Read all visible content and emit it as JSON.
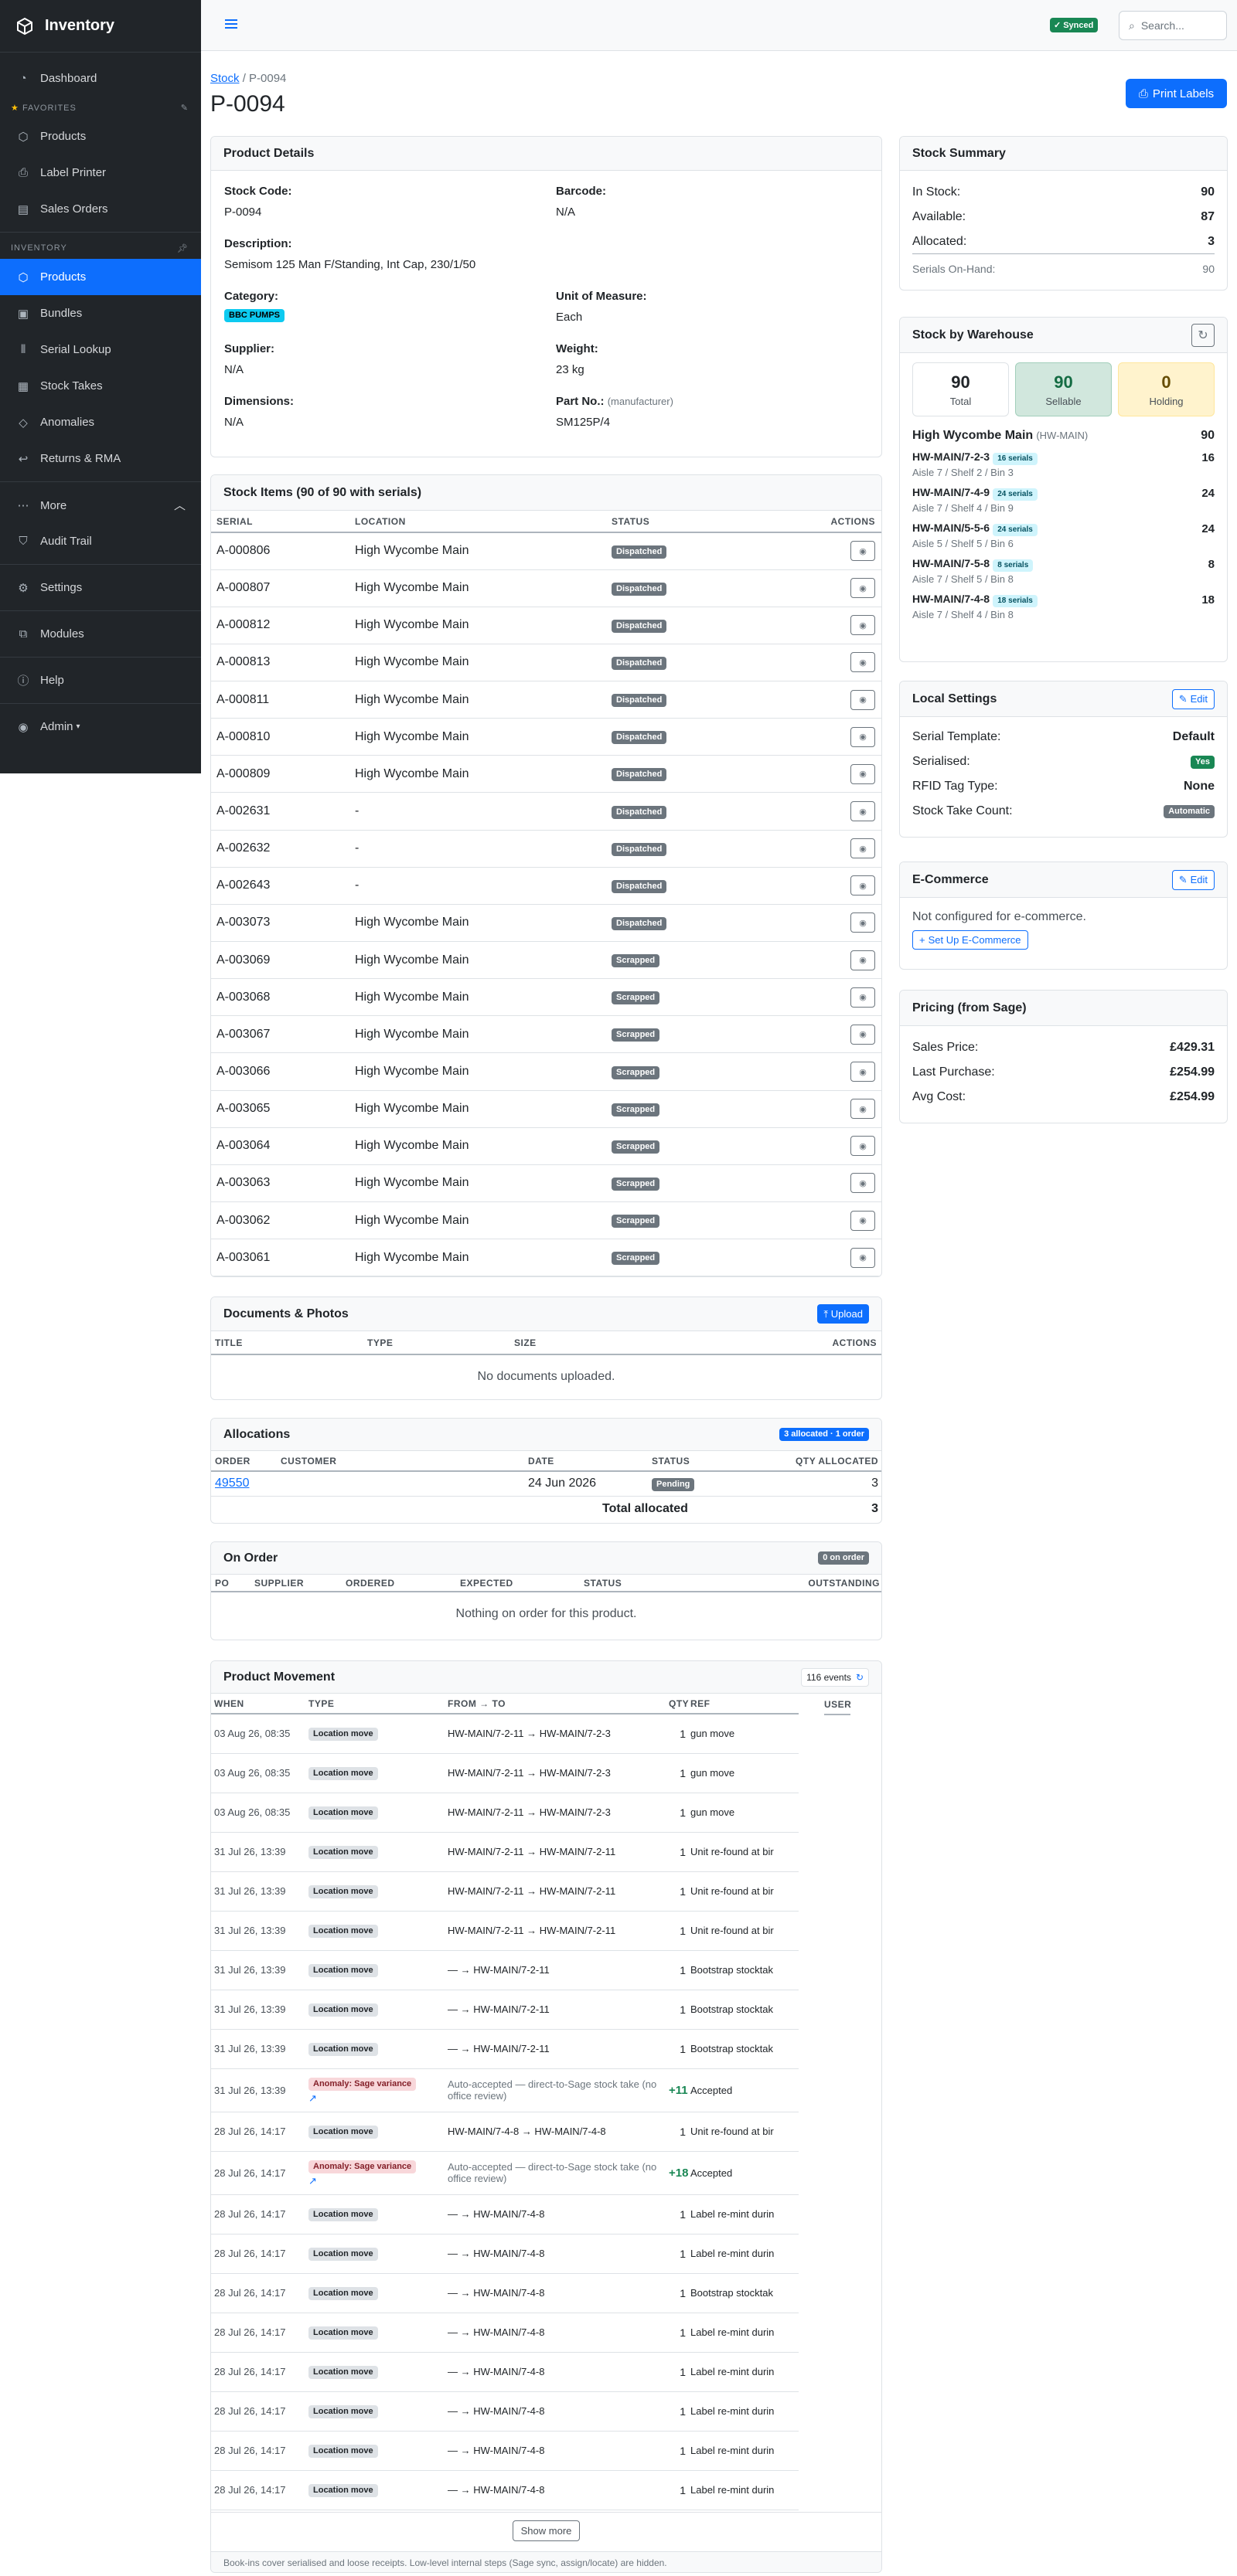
{
  "app": {
    "name": "Inventory"
  },
  "sidebar": {
    "dashboard": "Dashboard",
    "favorites_header": "FAVORITES",
    "favorites": [
      "Products",
      "Label Printer",
      "Sales Orders"
    ],
    "inventory_header": "INVENTORY",
    "inventory": [
      "Products",
      "Bundles",
      "Serial Lookup",
      "Stock Takes",
      "Anomalies",
      "Returns & RMA"
    ],
    "more": "More",
    "more_items": [
      "Audit Trail",
      "Settings",
      "Modules",
      "Help"
    ],
    "user": "Admin"
  },
  "topbar": {
    "synced": "Synced",
    "search_placeholder": "Search..."
  },
  "breadcrumb": {
    "root": "Stock",
    "current": "P-0094"
  },
  "page": {
    "title": "P-0094",
    "print_labels": "Print Labels"
  },
  "product_details": {
    "header": "Product Details",
    "stock_code_label": "Stock Code:",
    "stock_code": "P-0094",
    "barcode_label": "Barcode:",
    "barcode": "N/A",
    "description_label": "Description:",
    "description": "Semisom 125 Man F/Standing, Int Cap, 230/1/50",
    "category_label": "Category:",
    "category": "BBC PUMPS",
    "uom_label": "Unit of Measure:",
    "uom": "Each",
    "supplier_label": "Supplier:",
    "supplier": "N/A",
    "weight_label": "Weight:",
    "weight": "23 kg",
    "dimensions_label": "Dimensions:",
    "dimensions": "N/A",
    "partno_label": "Part No.:",
    "partno_hint": "(manufacturer)",
    "partno": "SM125P/4"
  },
  "stock_items": {
    "header": "Stock Items (90 of 90 with serials)",
    "columns": [
      "SERIAL",
      "LOCATION",
      "STATUS",
      "ACTIONS"
    ],
    "rows": [
      {
        "serial": "A-000806",
        "location": "High Wycombe Main",
        "status": "Dispatched"
      },
      {
        "serial": "A-000807",
        "location": "High Wycombe Main",
        "status": "Dispatched"
      },
      {
        "serial": "A-000812",
        "location": "High Wycombe Main",
        "status": "Dispatched"
      },
      {
        "serial": "A-000813",
        "location": "High Wycombe Main",
        "status": "Dispatched"
      },
      {
        "serial": "A-000811",
        "location": "High Wycombe Main",
        "status": "Dispatched"
      },
      {
        "serial": "A-000810",
        "location": "High Wycombe Main",
        "status": "Dispatched"
      },
      {
        "serial": "A-000809",
        "location": "High Wycombe Main",
        "status": "Dispatched"
      },
      {
        "serial": "A-002631",
        "location": "-",
        "status": "Dispatched"
      },
      {
        "serial": "A-002632",
        "location": "-",
        "status": "Dispatched"
      },
      {
        "serial": "A-002643",
        "location": "-",
        "status": "Dispatched"
      },
      {
        "serial": "A-003073",
        "location": "High Wycombe Main",
        "status": "Dispatched"
      },
      {
        "serial": "A-003069",
        "location": "High Wycombe Main",
        "status": "Scrapped"
      },
      {
        "serial": "A-003068",
        "location": "High Wycombe Main",
        "status": "Scrapped"
      },
      {
        "serial": "A-003067",
        "location": "High Wycombe Main",
        "status": "Scrapped"
      },
      {
        "serial": "A-003066",
        "location": "High Wycombe Main",
        "status": "Scrapped"
      },
      {
        "serial": "A-003065",
        "location": "High Wycombe Main",
        "status": "Scrapped"
      },
      {
        "serial": "A-003064",
        "location": "High Wycombe Main",
        "status": "Scrapped"
      },
      {
        "serial": "A-003063",
        "location": "High Wycombe Main",
        "status": "Scrapped"
      },
      {
        "serial": "A-003062",
        "location": "High Wycombe Main",
        "status": "Scrapped"
      },
      {
        "serial": "A-003061",
        "location": "High Wycombe Main",
        "status": "Scrapped"
      }
    ]
  },
  "documents": {
    "header": "Documents & Photos",
    "upload": "Upload",
    "columns": [
      "TITLE",
      "TYPE",
      "SIZE",
      "ACTIONS"
    ],
    "empty": "No documents uploaded."
  },
  "allocations": {
    "header": "Allocations",
    "badge": "3 allocated · 1 order",
    "columns": [
      "ORDER",
      "CUSTOMER",
      "DATE",
      "STATUS",
      "QTY ALLOCATED"
    ],
    "rows": [
      {
        "order": "49550",
        "customer": "",
        "date": "24 Jun 2026",
        "status": "Pending",
        "qty": "3"
      }
    ],
    "total_label": "Total allocated",
    "total": "3"
  },
  "on_order": {
    "header": "On Order",
    "badge": "0 on order",
    "columns": [
      "PO",
      "SUPPLIER",
      "ORDERED",
      "EXPECTED",
      "STATUS",
      "OUTSTANDING"
    ],
    "empty": "Nothing on order for this product."
  },
  "movement": {
    "header": "Product Movement",
    "events": "116 events",
    "columns": [
      "WHEN",
      "TYPE",
      "FROM → TO",
      "QTY",
      "REF",
      "USER"
    ],
    "rows": [
      {
        "when": "03 Aug 26, 08:35",
        "type": "Location move",
        "fromto": "HW-MAIN/7-2-11 → HW-MAIN/7-2-3",
        "qty": "1",
        "ref": "gun move"
      },
      {
        "when": "03 Aug 26, 08:35",
        "type": "Location move",
        "fromto": "HW-MAIN/7-2-11 → HW-MAIN/7-2-3",
        "qty": "1",
        "ref": "gun move"
      },
      {
        "when": "03 Aug 26, 08:35",
        "type": "Location move",
        "fromto": "HW-MAIN/7-2-11 → HW-MAIN/7-2-3",
        "qty": "1",
        "ref": "gun move"
      },
      {
        "when": "31 Jul 26, 13:39",
        "type": "Location move",
        "fromto": "HW-MAIN/7-2-11 → HW-MAIN/7-2-11",
        "qty": "1",
        "ref": "Unit re-found at bir"
      },
      {
        "when": "31 Jul 26, 13:39",
        "type": "Location move",
        "fromto": "HW-MAIN/7-2-11 → HW-MAIN/7-2-11",
        "qty": "1",
        "ref": "Unit re-found at bir"
      },
      {
        "when": "31 Jul 26, 13:39",
        "type": "Location move",
        "fromto": "HW-MAIN/7-2-11 → HW-MAIN/7-2-11",
        "qty": "1",
        "ref": "Unit re-found at bir"
      },
      {
        "when": "31 Jul 26, 13:39",
        "type": "Location move",
        "fromto": "— → HW-MAIN/7-2-11",
        "qty": "1",
        "ref": "Bootstrap stocktak"
      },
      {
        "when": "31 Jul 26, 13:39",
        "type": "Location move",
        "fromto": "— → HW-MAIN/7-2-11",
        "qty": "1",
        "ref": "Bootstrap stocktak"
      },
      {
        "when": "31 Jul 26, 13:39",
        "type": "Location move",
        "fromto": "— → HW-MAIN/7-2-11",
        "qty": "1",
        "ref": "Bootstrap stocktak"
      },
      {
        "when": "31 Jul 26, 13:39",
        "type": "Anomaly: Sage variance",
        "anomaly": true,
        "fromto": "Auto-accepted — direct-to-Sage stock take (no office review)",
        "qty": "+11",
        "ref": "Accepted"
      },
      {
        "when": "28 Jul 26, 14:17",
        "type": "Location move",
        "fromto": "HW-MAIN/7-4-8 → HW-MAIN/7-4-8",
        "qty": "1",
        "ref": "Unit re-found at bir"
      },
      {
        "when": "28 Jul 26, 14:17",
        "type": "Anomaly: Sage variance",
        "anomaly": true,
        "fromto": "Auto-accepted — direct-to-Sage stock take (no office review)",
        "qty": "+18",
        "ref": "Accepted"
      },
      {
        "when": "28 Jul 26, 14:17",
        "type": "Location move",
        "fromto": "— → HW-MAIN/7-4-8",
        "qty": "1",
        "ref": "Label re-mint durin"
      },
      {
        "when": "28 Jul 26, 14:17",
        "type": "Location move",
        "fromto": "— → HW-MAIN/7-4-8",
        "qty": "1",
        "ref": "Label re-mint durin"
      },
      {
        "when": "28 Jul 26, 14:17",
        "type": "Location move",
        "fromto": "— → HW-MAIN/7-4-8",
        "qty": "1",
        "ref": "Bootstrap stocktak"
      },
      {
        "when": "28 Jul 26, 14:17",
        "type": "Location move",
        "fromto": "— → HW-MAIN/7-4-8",
        "qty": "1",
        "ref": "Label re-mint durin"
      },
      {
        "when": "28 Jul 26, 14:17",
        "type": "Location move",
        "fromto": "— → HW-MAIN/7-4-8",
        "qty": "1",
        "ref": "Label re-mint durin"
      },
      {
        "when": "28 Jul 26, 14:17",
        "type": "Location move",
        "fromto": "— → HW-MAIN/7-4-8",
        "qty": "1",
        "ref": "Label re-mint durin"
      },
      {
        "when": "28 Jul 26, 14:17",
        "type": "Location move",
        "fromto": "— → HW-MAIN/7-4-8",
        "qty": "1",
        "ref": "Label re-mint durin"
      },
      {
        "when": "28 Jul 26, 14:17",
        "type": "Location move",
        "fromto": "— → HW-MAIN/7-4-8",
        "qty": "1",
        "ref": "Label re-mint durin"
      }
    ],
    "show_more": "Show more",
    "footnote": "Book-ins cover serialised and loose receipts. Low-level internal steps (Sage sync, assign/locate) are hidden."
  },
  "stock_summary": {
    "header": "Stock Summary",
    "in_stock_label": "In Stock:",
    "in_stock": "90",
    "available_label": "Available:",
    "available": "87",
    "allocated_label": "Allocated:",
    "allocated": "3",
    "serials_label": "Serials On-Hand:",
    "serials": "90"
  },
  "warehouse": {
    "header": "Stock by Warehouse",
    "total": "90",
    "total_label": "Total",
    "sellable": "90",
    "sellable_label": "Sellable",
    "holding": "0",
    "holding_label": "Holding",
    "site_name": "High Wycombe Main",
    "site_code": "(HW-MAIN)",
    "site_qty": "90",
    "bins": [
      {
        "code": "HW-MAIN/7-2-3",
        "serials": "16 serials",
        "desc": "Aisle 7 / Shelf 2 / Bin 3",
        "qty": "16"
      },
      {
        "code": "HW-MAIN/7-4-9",
        "serials": "24 serials",
        "desc": "Aisle 7 / Shelf 4 / Bin 9",
        "qty": "24"
      },
      {
        "code": "HW-MAIN/5-5-6",
        "serials": "24 serials",
        "desc": "Aisle 5 / Shelf 5 / Bin 6",
        "qty": "24"
      },
      {
        "code": "HW-MAIN/7-5-8",
        "serials": "8 serials",
        "desc": "Aisle 7 / Shelf 5 / Bin 8",
        "qty": "8"
      },
      {
        "code": "HW-MAIN/7-4-8",
        "serials": "18 serials",
        "desc": "Aisle 7 / Shelf 4 / Bin 8",
        "qty": "18"
      }
    ]
  },
  "local_settings": {
    "header": "Local Settings",
    "edit": "Edit",
    "serial_template_label": "Serial Template:",
    "serial_template": "Default",
    "serialised_label": "Serialised:",
    "serialised": "Yes",
    "rfid_label": "RFID Tag Type:",
    "rfid": "None",
    "stock_take_label": "Stock Take Count:",
    "stock_take": "Automatic"
  },
  "ecommerce": {
    "header": "E-Commerce",
    "edit": "Edit",
    "text": "Not configured for e-commerce.",
    "setup": "Set Up E-Commerce"
  },
  "pricing": {
    "header": "Pricing (from Sage)",
    "sales_label": "Sales Price:",
    "sales": "£429.31",
    "purchase_label": "Last Purchase:",
    "purchase": "£254.99",
    "avg_label": "Avg Cost:",
    "avg": "£254.99"
  }
}
